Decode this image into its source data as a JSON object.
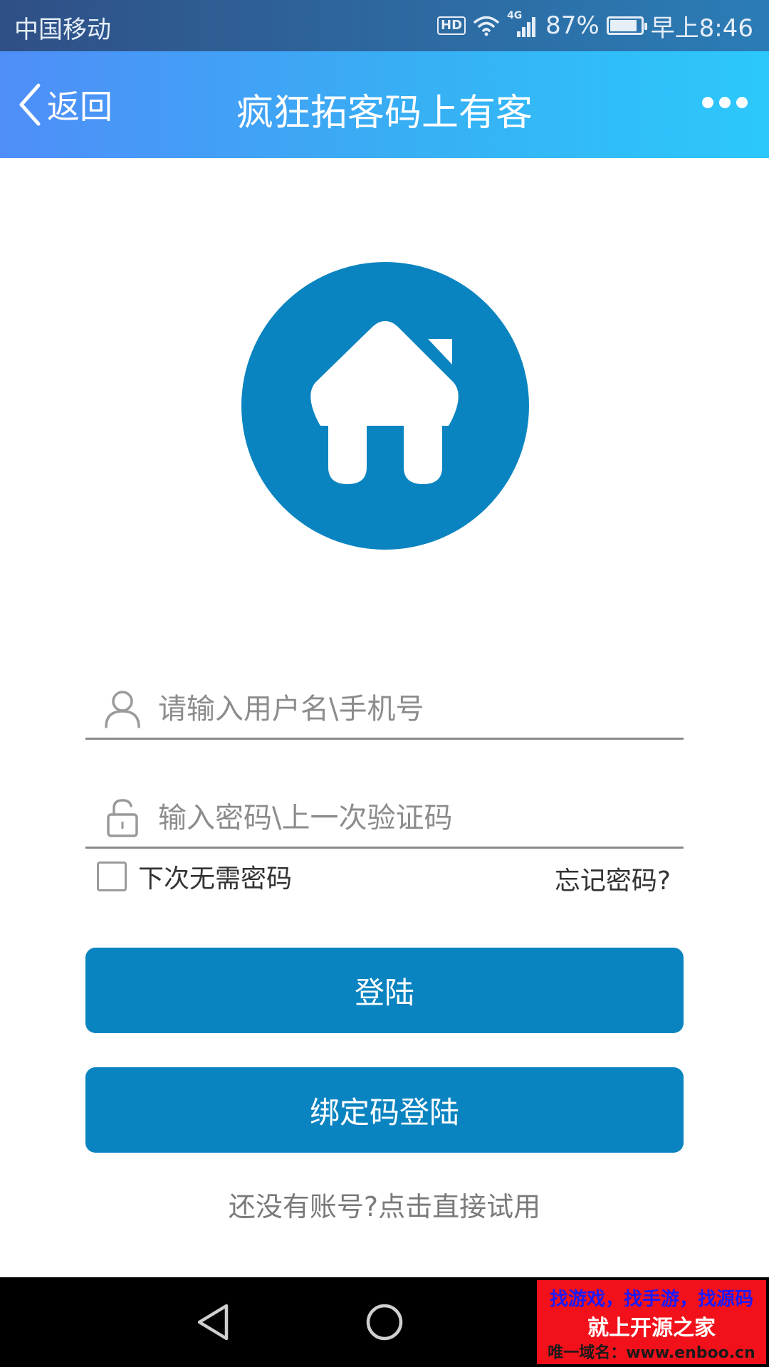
{
  "status_bar": {
    "carrier": "中国移动",
    "hd_label": "HD",
    "network": "4G",
    "battery_percent": "87%",
    "battery_level": 0.87,
    "time": "早上8:46"
  },
  "nav": {
    "back_label": "返回",
    "title": "疯狂拓客码上有客"
  },
  "colors": {
    "primary": "#0a84c0",
    "nav_gradient_start": "#4f8ef8",
    "nav_gradient_end": "#2cc8fb"
  },
  "form": {
    "username_placeholder": "请输入用户名\\手机号",
    "password_placeholder": "输入密码\\上一次验证码",
    "remember_label": "下次无需密码",
    "remember_checked": false,
    "forgot_label": "忘记密码?"
  },
  "buttons": {
    "login_label": "登陆",
    "bind_login_label": "绑定码登陆",
    "trial_label": "还没有账号?点击直接试用"
  },
  "watermark": {
    "line1": "找游戏，找手游，找源码",
    "line2": "就上开源之家",
    "line3": "唯一域名：www.enboo.cn"
  }
}
